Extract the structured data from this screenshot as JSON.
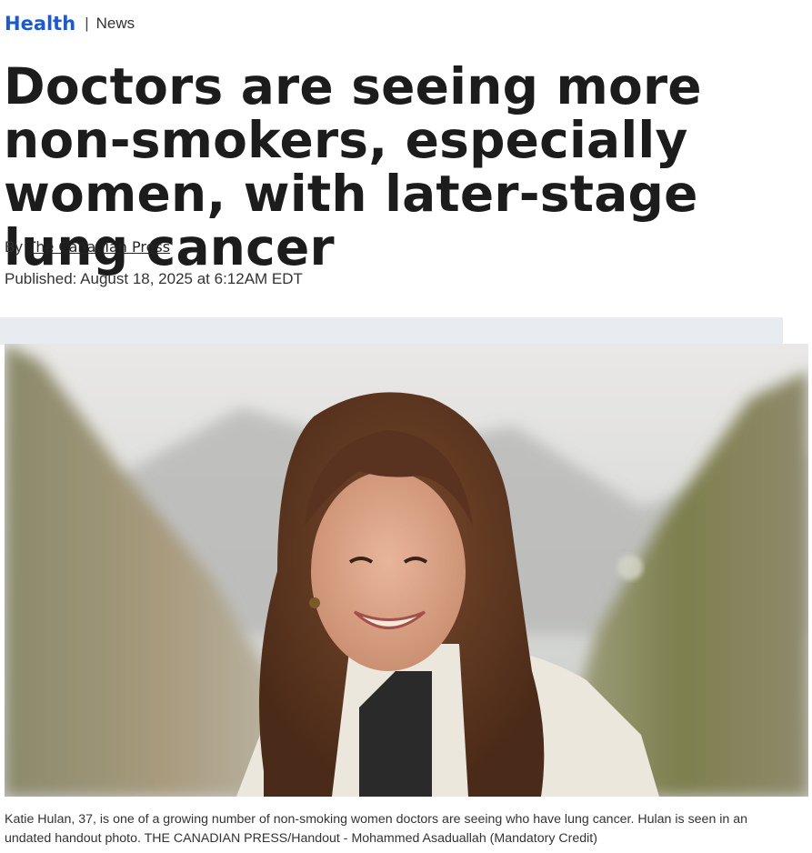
{
  "breadcrumb": {
    "section": "Health",
    "separator": "|",
    "subsection": "News"
  },
  "article": {
    "title": "Doctors are seeing more non-smokers, especially women, with later-stage lung cancer",
    "byline_prefix": "By",
    "author": "The Canadian Press",
    "published": "Published: August 18, 2025 at 6:12AM EDT"
  },
  "photo": {
    "caption": "Katie Hulan, 37, is one of a growing number of non-smoking women doctors are seeing who have lung cancer. Hulan is seen in an undated handout photo. THE CANADIAN PRESS/Handout - Mohammed Asaduallah (Mandatory Credit)"
  },
  "colors": {
    "accent": "#1a5ad7",
    "text": "#1c1c1c",
    "band": "#e8ecf1"
  }
}
